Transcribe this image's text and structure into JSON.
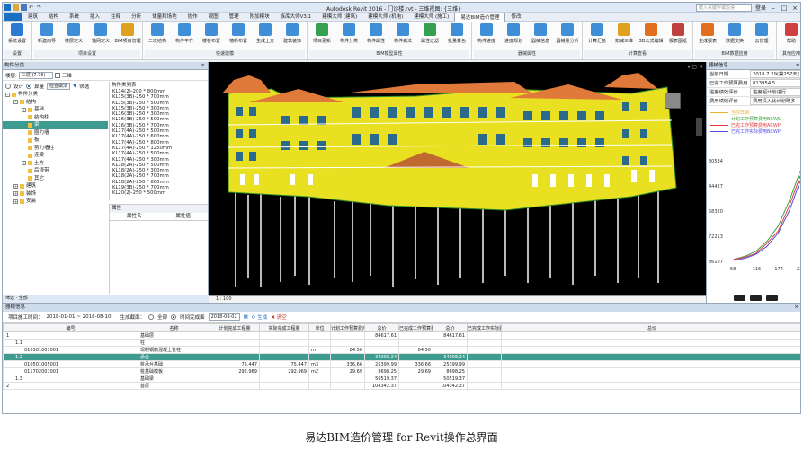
{
  "window": {
    "title": "Autodesk Revit 2016 -   门诊楼.rvt - 三维视图: {三维}",
    "search_placeholder": "键入关键字或短语",
    "user_label": "登录"
  },
  "menu": {
    "tabs": [
      "建筑",
      "结构",
      "系统",
      "插入",
      "注释",
      "分析",
      "体量和场地",
      "协作",
      "视图",
      "管理",
      "附加模块",
      "族库大师V3.1",
      "建模大师 (建筑)",
      "建模大师 (机电)",
      "建模大师 (施工)",
      "易达BIM造价管理",
      "修改"
    ],
    "active_index": 15
  },
  "ribbon": {
    "groups": [
      {
        "name": "设置",
        "buttons": [
          {
            "label": "系统设置",
            "icon": "gear-icon",
            "color": "#2b7bd3"
          }
        ]
      },
      {
        "name": "项目设置",
        "buttons": [
          {
            "label": "新建向导",
            "icon": "wizard-icon",
            "color": "#3e8ed8"
          },
          {
            "label": "楼层定义",
            "icon": "floor-icon",
            "color": "#3e8ed8"
          },
          {
            "label": "轴网定义",
            "icon": "grid-icon",
            "color": "#3e8ed8"
          },
          {
            "label": "BIM项目管理",
            "icon": "project-icon",
            "color": "#e0a020"
          }
        ]
      },
      {
        "name": "快速建模",
        "buttons": [
          {
            "label": "二次结构",
            "icon": "structure-icon",
            "color": "#3e8ed8"
          },
          {
            "label": "构件平齐",
            "icon": "align-icon",
            "color": "#3e8ed8"
          },
          {
            "label": "楼板布置",
            "icon": "slab-icon",
            "color": "#3e8ed8"
          },
          {
            "label": "墙新布置",
            "icon": "wall-icon",
            "color": "#3e8ed8"
          },
          {
            "label": "生成土方",
            "icon": "earth-icon",
            "color": "#3e8ed8"
          },
          {
            "label": "建筑装饰",
            "icon": "decor-icon",
            "color": "#3e8ed8"
          }
        ]
      },
      {
        "name": "BIM模型属性",
        "buttons": [
          {
            "label": "项目更新",
            "icon": "refresh-icon",
            "color": "#35a050"
          },
          {
            "label": "构件分类",
            "icon": "classify-icon",
            "color": "#3e8ed8"
          },
          {
            "label": "构件属性",
            "icon": "props-icon",
            "color": "#3e8ed8"
          },
          {
            "label": "构件做法",
            "icon": "method-icon",
            "color": "#3e8ed8"
          },
          {
            "label": "属性过滤",
            "icon": "filter-icon",
            "color": "#35a050"
          },
          {
            "label": "批量着色",
            "icon": "paint-icon",
            "color": "#3e8ed8"
          }
        ]
      },
      {
        "name": "器械属性",
        "buttons": [
          {
            "label": "构件进度",
            "icon": "progress-icon",
            "color": "#3e8ed8"
          },
          {
            "label": "进度规划",
            "icon": "plan-icon",
            "color": "#3e8ed8"
          },
          {
            "label": "器械信息",
            "icon": "info-icon",
            "color": "#3e8ed8"
          },
          {
            "label": "器械量分析",
            "icon": "analysis-icon",
            "color": "#3e8ed8"
          }
        ]
      },
      {
        "name": "计算查看",
        "buttons": [
          {
            "label": "计算汇总",
            "icon": "calc-icon",
            "color": "#3e8ed8"
          },
          {
            "label": "扣减三维",
            "icon": "cube-icon",
            "color": "#e0a020"
          },
          {
            "label": "3D公式编辑",
            "icon": "formula-icon",
            "color": "#e07020"
          },
          {
            "label": "报表图纸",
            "icon": "report-icon",
            "color": "#c04040"
          }
        ]
      },
      {
        "name": "BIM数据应用",
        "buttons": [
          {
            "label": "生成报表",
            "icon": "export-icon",
            "color": "#e07020"
          },
          {
            "label": "数据交换",
            "icon": "exchange-icon",
            "color": "#3e8ed8"
          },
          {
            "label": "云管理",
            "icon": "cloud-icon",
            "color": "#3e8ed8"
          }
        ]
      },
      {
        "name": "其他应用",
        "buttons": [
          {
            "label": "帮助",
            "icon": "help-icon",
            "color": "#d04040"
          }
        ]
      }
    ]
  },
  "left_panel": {
    "title": "构件分类",
    "floor_label": "楼层:",
    "floor_value": "二层 (7.76)",
    "three_dim_label": "三维",
    "mode_design": "设计",
    "mode_quantity": "算量",
    "check_btn": "检查做法",
    "filter_btn": "筛选",
    "tree": [
      {
        "label": "构件分类",
        "depth": 0,
        "toggle": "-"
      },
      {
        "label": "结构",
        "depth": 1,
        "toggle": "-"
      },
      {
        "label": "基础",
        "depth": 2,
        "toggle": "+"
      },
      {
        "label": "结构柱",
        "depth": 2,
        "toggle": ""
      },
      {
        "label": "梁",
        "depth": 2,
        "toggle": "",
        "selected": true
      },
      {
        "label": "圈力墙",
        "depth": 2,
        "toggle": ""
      },
      {
        "label": "板",
        "depth": 2,
        "toggle": ""
      },
      {
        "label": "剪力墙柱",
        "depth": 2,
        "toggle": ""
      },
      {
        "label": "连梁",
        "depth": 2,
        "toggle": ""
      },
      {
        "label": "土方",
        "depth": 2,
        "toggle": "+"
      },
      {
        "label": "后浇带",
        "depth": 2,
        "toggle": ""
      },
      {
        "label": "其它",
        "depth": 2,
        "toggle": ""
      },
      {
        "label": "建筑",
        "depth": 1,
        "toggle": "+"
      },
      {
        "label": "装饰",
        "depth": 1,
        "toggle": "+"
      },
      {
        "label": "安装",
        "depth": 1,
        "toggle": "+"
      }
    ],
    "list_header": "构件类列表",
    "components": [
      "KL14(2)-200 * 800mm",
      "KL15(3B)-250 * 700mm",
      "KL15(3B)-250 * 500mm",
      "KL15(3B)-250 * 300mm",
      "KL16(3B)-250 * 300mm",
      "KL16(3B)-250 * 500mm",
      "KL16(3B)-250 * 700mm",
      "KL17(4A)-250 * 500mm",
      "KL17(4A)-250 * 600mm",
      "KL17(4A)-250 * 800mm",
      "KL17(4A)-250 * 1250mm",
      "KL17(4A)-250 * 500mm",
      "KL17(4A)-250 * 300mm",
      "KL18(2A)-250 * 500mm",
      "KL18(2A)-250 * 300mm",
      "KL18(2A)-250 * 700mm",
      "KL18(2A)-250 * 800mm",
      "KL19(3B)-250 * 700mm",
      "KL20(2)-250 * 500mm"
    ],
    "prop_header": "属性",
    "prop_col1": "属性名",
    "prop_col2": "属性值",
    "footer": "筛选 · 全部"
  },
  "viewport": {
    "scale": "1 : 100",
    "close": "▾ ▢ ✕"
  },
  "right_panel": {
    "title": "器械信息",
    "rows": [
      {
        "k": "当前日期",
        "v": "2018.7.29(第257天)"
      },
      {
        "k": "已完工作预算费用",
        "v": "813954.5"
      },
      {
        "k": "进度绩效评价",
        "v": "进度超计划进行"
      },
      {
        "k": "费用绩效评价",
        "v": "费用投入比计划略多"
      }
    ],
    "legend": [
      {
        "label": "当前日期",
        "color": "#f0b030"
      },
      {
        "label": "计划工作预算费用BCWS",
        "color": "#40a040"
      },
      {
        "label": "已完工作预算费用ACWP",
        "color": "#e04040"
      },
      {
        "label": "已完工作实际费用BCWP",
        "color": "#5050e0"
      }
    ]
  },
  "chart_data": {
    "type": "line",
    "x": [
      58,
      116,
      174,
      232
    ],
    "ylabels": [
      30534,
      44427,
      58320,
      72213,
      86107
    ],
    "series": [
      {
        "name": "计划工作预算费用BCWS",
        "color": "#40a040"
      },
      {
        "name": "已完工作预算费用ACWP",
        "color": "#e04040"
      },
      {
        "name": "已完工作实际费用BCWP",
        "color": "#5050e0"
      }
    ]
  },
  "bottom": {
    "title": "器械信息",
    "start_label": "项目施工时间：",
    "start_range": "2018-01-01 ~ 2018-08-10",
    "gen_label": "生成截面：",
    "opt_all": "全部",
    "opt_time": "时间完成面",
    "date_value": "2018-08-02",
    "generate": "生成",
    "clear": "清空",
    "headers": [
      "编号",
      "名称",
      "计划完成工程量",
      "实际完成工程量",
      "单位",
      "计划工作预算费用BCWS 单价",
      "总价",
      "已完成工作预算费用BCWP 单价",
      "总价",
      "已完成工作实际费用ACWP 单价",
      "总价"
    ],
    "rows": [
      {
        "code": "1",
        "name": "基础层",
        "plan": "",
        "actual": "",
        "unit": "",
        "p1": "",
        "t1": "84617.61",
        "p2": "",
        "t2": "84617.61",
        "p3": "",
        "t3": "",
        "indent": 0,
        "hl": false
      },
      {
        "code": "1.1",
        "name": "柱",
        "plan": "",
        "actual": "",
        "unit": "",
        "p1": "",
        "t1": "",
        "p2": "",
        "t2": "",
        "p3": "",
        "t3": "",
        "indent": 1,
        "hl": false
      },
      {
        "code": "010301001001",
        "name": "现制钢筋混凝土管柱",
        "plan": "",
        "actual": "",
        "unit": "m",
        "p1": "84.50",
        "t1": "",
        "p2": "84.50",
        "t2": "",
        "p3": "",
        "t3": "",
        "indent": 2,
        "hl": false
      },
      {
        "code": "1.2",
        "name": "承台",
        "plan": "",
        "actual": "",
        "unit": "",
        "p1": "",
        "t1": "34098.24",
        "p2": "",
        "t2": "34098.24",
        "p3": "",
        "t3": "",
        "indent": 1,
        "hl": true
      },
      {
        "code": "010501005001",
        "name": "桩承台基础",
        "plan": "75.447",
        "actual": "75.447",
        "unit": "m3",
        "p1": "336.66",
        "t1": "25399.99",
        "p2": "336.66",
        "t2": "25399.99",
        "p3": "",
        "t3": "",
        "indent": 2,
        "hl": false
      },
      {
        "code": "011702001001",
        "name": "桩基础模板",
        "plan": "292.969",
        "actual": "292.969",
        "unit": "m2",
        "p1": "29.69",
        "t1": "8698.25",
        "p2": "29.69",
        "t2": "8698.25",
        "p3": "",
        "t3": "",
        "indent": 2,
        "hl": false
      },
      {
        "code": "1.3",
        "name": "基础梁",
        "plan": "",
        "actual": "",
        "unit": "",
        "p1": "",
        "t1": "50519.37",
        "p2": "",
        "t2": "50519.37",
        "p3": "",
        "t3": "",
        "indent": 1,
        "hl": false
      },
      {
        "code": "2",
        "name": "首层",
        "plan": "",
        "actual": "",
        "unit": "",
        "p1": "",
        "t1": "104342.37",
        "p2": "",
        "t2": "104342.37",
        "p3": "",
        "t3": "",
        "indent": 0,
        "hl": false
      }
    ]
  },
  "caption": "易达BIM造价管理 for Revit操作总界面"
}
